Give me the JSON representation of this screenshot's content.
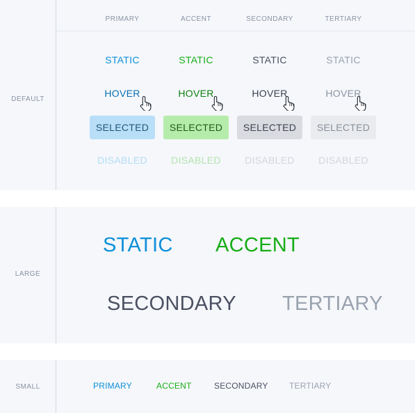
{
  "columns": [
    "PRIMARY",
    "ACCENT",
    "SECONDARY",
    "TERTIARY"
  ],
  "default_section": {
    "label": "DEFAULT",
    "rows": {
      "static": [
        "STATIC",
        "STATIC",
        "STATIC",
        "STATIC"
      ],
      "hover": [
        "HOVER",
        "HOVER",
        "HOVER",
        "HOVER"
      ],
      "selected": [
        "SELECTED",
        "SELECTED",
        "SELECTED",
        "SELECTED"
      ],
      "disabled": [
        "DISABLED",
        "DISABLED",
        "DISABLED",
        "DISABLED"
      ]
    }
  },
  "large_section": {
    "label": "LARGE",
    "items": [
      "STATIC",
      "ACCENT",
      "SECONDARY",
      "TERTIARY"
    ]
  },
  "small_section": {
    "label": "SMALL",
    "items": [
      "PRIMARY",
      "ACCENT",
      "SECONDARY",
      "TERTIARY"
    ]
  },
  "colors": {
    "primary": "#0d8fd8",
    "accent": "#16ad16",
    "secondary": "#4b5061",
    "tertiary": "#9aa2ae",
    "panel_background": "#f5f7fb"
  },
  "icons": {
    "cursor": "hand-pointer-icon"
  }
}
